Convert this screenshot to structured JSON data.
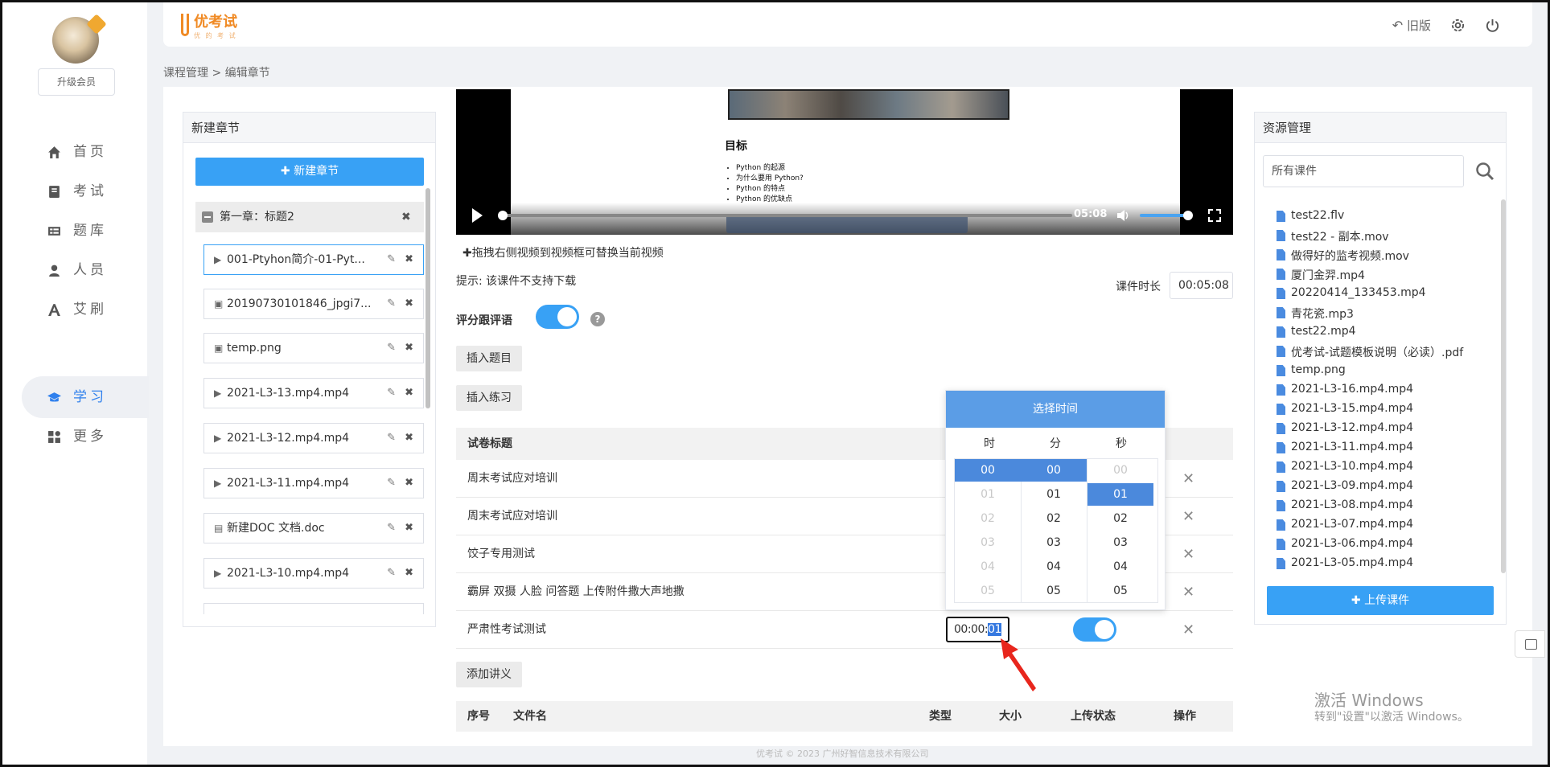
{
  "sidebar": {
    "upgrade": "升级会员",
    "items": [
      {
        "label": "首页",
        "icon": "home-icon"
      },
      {
        "label": "考试",
        "icon": "exam-icon"
      },
      {
        "label": "题库",
        "icon": "question-bank-icon"
      },
      {
        "label": "人员",
        "icon": "user-icon"
      },
      {
        "label": "艾刷",
        "icon": "font-a-icon"
      },
      {
        "label": "学习",
        "icon": "graduation-cap-icon",
        "active": true
      },
      {
        "label": "更多",
        "icon": "grid-icon"
      }
    ]
  },
  "header": {
    "logo": "优考试",
    "logo_sub": "优 的 考 试",
    "old_version": "旧版"
  },
  "breadcrumb": {
    "root": "课程管理",
    "sep": ">",
    "current": "编辑章节"
  },
  "chapters": {
    "title": "新建章节",
    "new_button": "新建章节",
    "chapter_label": "第一章：标题2",
    "items": [
      {
        "name": "001-Ptyhon简介-01-Pyt...",
        "type": "video"
      },
      {
        "name": "20190730101846_jpgi7...",
        "type": "image"
      },
      {
        "name": "temp.png",
        "type": "image"
      },
      {
        "name": "2021-L3-13.mp4.mp4",
        "type": "video"
      },
      {
        "name": "2021-L3-12.mp4.mp4",
        "type": "video"
      },
      {
        "name": "2021-L3-11.mp4.mp4",
        "type": "video"
      },
      {
        "name": "新建DOC 文档.doc",
        "type": "doc"
      },
      {
        "name": "2021-L3-10.mp4.mp4",
        "type": "video"
      }
    ]
  },
  "video": {
    "slide_title": "目标",
    "slide_list": [
      "Python 的起源",
      "为什么要用 Python?",
      "Python 的特点",
      "Python 的优缺点"
    ],
    "time": "05:08",
    "progress": 0.0
  },
  "main": {
    "drag_hint": "✚拖拽右侧视频到视频框可替换当前视频",
    "no_download": "提示: 该课件不支持下载",
    "duration_label": "课件时长",
    "duration_value": "00:05:08",
    "rating_label": "评分跟评语",
    "insert_question": "插入题目",
    "insert_practice": "插入练习",
    "exam_header": "试卷标题",
    "exams": [
      "周末考试应对培训",
      "周末考试应对培训",
      "饺子专用测试",
      "霸屏 双摄 人脸 问答题 上传附件撒大声地撒",
      "严肃性考试测试"
    ],
    "time_value_prefix": "00:00:",
    "time_value_selected": "01",
    "add_notes": "添加讲义",
    "file_table": {
      "headers": [
        "序号",
        "文件名",
        "类型",
        "大小",
        "上传状态",
        "操作"
      ]
    }
  },
  "time_picker": {
    "title": "选择时间",
    "columns": [
      "时",
      "分",
      "秒"
    ],
    "values": [
      "00",
      "01",
      "02",
      "03",
      "04",
      "05"
    ]
  },
  "resources": {
    "title": "资源管理",
    "search_placeholder": "所有课件",
    "upload_button": "上传课件",
    "files": [
      "test22.flv",
      "test22 - 副本.mov",
      "做得好的监考视频.mov",
      "厦门金羿.mp4",
      "20220414_133453.mp4",
      "青花瓷.mp3",
      "test22.mp4",
      "优考试-试题模板说明（必读）.pdf",
      "temp.png",
      "2021-L3-16.mp4.mp4",
      "2021-L3-15.mp4.mp4",
      "2021-L3-12.mp4.mp4",
      "2021-L3-11.mp4.mp4",
      "2021-L3-10.mp4.mp4",
      "2021-L3-09.mp4.mp4",
      "2021-L3-08.mp4.mp4",
      "2021-L3-07.mp4.mp4",
      "2021-L3-06.mp4.mp4",
      "2021-L3-05.mp4.mp4"
    ]
  },
  "watermark": {
    "line1": "激活 Windows",
    "line2": "转到\"设置\"以激活 Windows。"
  },
  "footer": "优考试 © 2023 广州好智信息技术有限公司",
  "colors": {
    "accent": "#38a1f5",
    "picker_header": "#5b9de6",
    "logo": "#f08a24"
  }
}
